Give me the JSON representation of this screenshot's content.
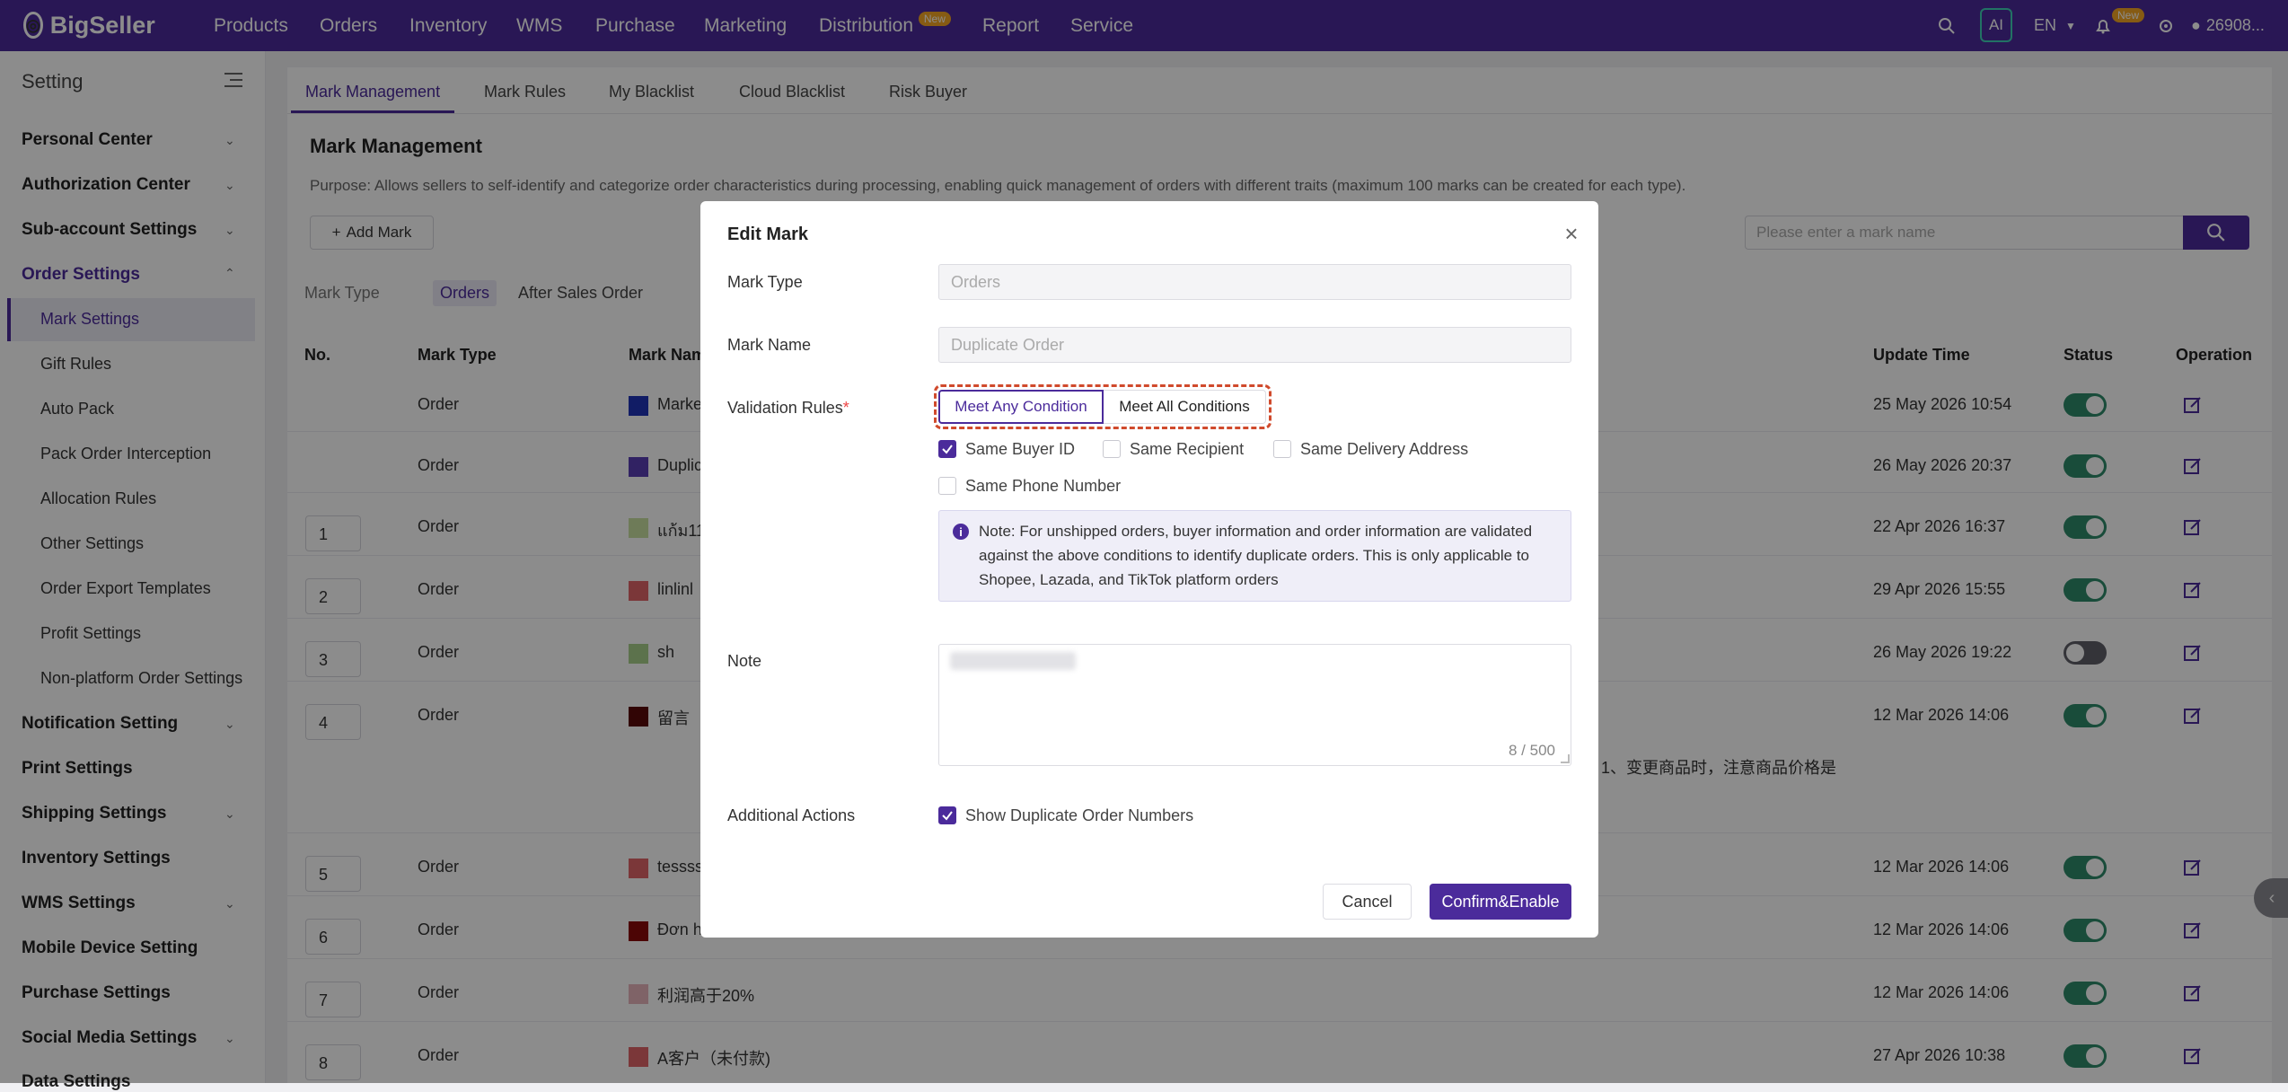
{
  "app": {
    "logo_text": "BigSeller",
    "nav": [
      "Products",
      "Orders",
      "Inventory",
      "WMS",
      "Purchase",
      "Marketing",
      "Distribution",
      "Report",
      "Service"
    ],
    "new_badge": "New",
    "ai_label": "AI",
    "lang": "EN",
    "user": "26908..."
  },
  "sidebar": {
    "title": "Setting",
    "groups": [
      "Personal Center",
      "Authorization Center",
      "Sub-account Settings",
      "Order Settings"
    ],
    "order_settings_items": [
      "Mark Settings",
      "Gift Rules",
      "Auto Pack",
      "Pack Order Interception",
      "Allocation Rules",
      "Other Settings",
      "Order Export Templates",
      "Profit Settings",
      "Non-platform Order Settings"
    ],
    "more_groups": [
      "Notification Setting",
      "Print Settings",
      "Shipping Settings",
      "Inventory Settings",
      "WMS Settings",
      "Mobile Device Setting",
      "Purchase Settings",
      "Social Media Settings",
      "Data Settings"
    ]
  },
  "tabs": [
    "Mark Management",
    "Mark Rules",
    "My Blacklist",
    "Cloud Blacklist",
    "Risk Buyer"
  ],
  "page": {
    "title": "Mark Management",
    "purpose": "Purpose: Allows sellers to self-identify and categorize order characteristics during processing, enabling quick management of orders with different traits (maximum 100 marks can be created for each type).",
    "add_button": "Add Mark",
    "search_placeholder": "Please enter a mark name",
    "filter_label": "Mark Type",
    "filter_active": "Orders",
    "filter_other": "After Sales Order"
  },
  "table": {
    "headers": [
      "No.",
      "Mark Type",
      "Mark Name",
      "Update Time",
      "Status",
      "Operation"
    ],
    "rows": [
      {
        "no": "",
        "type": "Order",
        "name": "Marke",
        "color": "#1f34b8",
        "time": "25 May 2026 10:54",
        "on": true
      },
      {
        "no": "",
        "type": "Order",
        "name": "Duplic",
        "color": "#5a3fb5",
        "time": "26 May 2026 20:37",
        "on": true
      },
      {
        "no": "1",
        "type": "Order",
        "name": "แก้ม11",
        "color": "#c9e0a0",
        "time": "22 Apr 2026 16:37",
        "on": true
      },
      {
        "no": "2",
        "type": "Order",
        "name": "linlinl",
        "color": "#e06468",
        "time": "29 Apr 2026 15:55",
        "on": true
      },
      {
        "no": "3",
        "type": "Order",
        "name": "sh",
        "color": "#a8d08a",
        "time": "26 May 2026 19:22",
        "on": false
      },
      {
        "no": "4",
        "type": "Order",
        "name": "留言",
        "color": "#5a0a0a",
        "time": "12 Mar 2026 14:06",
        "on": true
      },
      {
        "no": "5",
        "type": "Order",
        "name": "tessss",
        "color": "#e06468",
        "time": "12 Mar 2026 14:06",
        "on": true
      },
      {
        "no": "6",
        "type": "Order",
        "name": "Đơn h",
        "color": "#8b0a0a",
        "time": "12 Mar 2026 14:06",
        "on": true
      },
      {
        "no": "7",
        "type": "Order",
        "name": "利润高于20%",
        "color": "#e8b4bc",
        "time": "12 Mar 2026 14:06",
        "on": true
      },
      {
        "no": "8",
        "type": "Order",
        "name": "A客户（未付款)",
        "color": "#e06468",
        "time": "27 Apr 2026 10:38",
        "on": true
      }
    ],
    "row4_note": "1、变更商品时，注意商品价格是"
  },
  "modal": {
    "title": "Edit Mark",
    "mark_type_label": "Mark Type",
    "mark_type_value": "Orders",
    "mark_name_label": "Mark Name",
    "mark_name_value": "Duplicate Order",
    "validation_label": "Validation Rules",
    "seg_any": "Meet Any Condition",
    "seg_all": "Meet All Conditions",
    "conditions": [
      {
        "label": "Same Buyer ID",
        "checked": true
      },
      {
        "label": "Same Recipient",
        "checked": false
      },
      {
        "label": "Same Delivery Address",
        "checked": false
      },
      {
        "label": "Same Phone Number",
        "checked": false
      }
    ],
    "note_text": "Note: For unshipped orders, buyer information and order information are validated against the above conditions to identify duplicate orders. This is only applicable to Shopee, Lazada, and TikTok platform orders",
    "note_label": "Note",
    "counter": "8 / 500",
    "additional_label": "Additional Actions",
    "show_dup": "Show Duplicate Order Numbers",
    "cancel": "Cancel",
    "confirm": "Confirm&Enable"
  }
}
